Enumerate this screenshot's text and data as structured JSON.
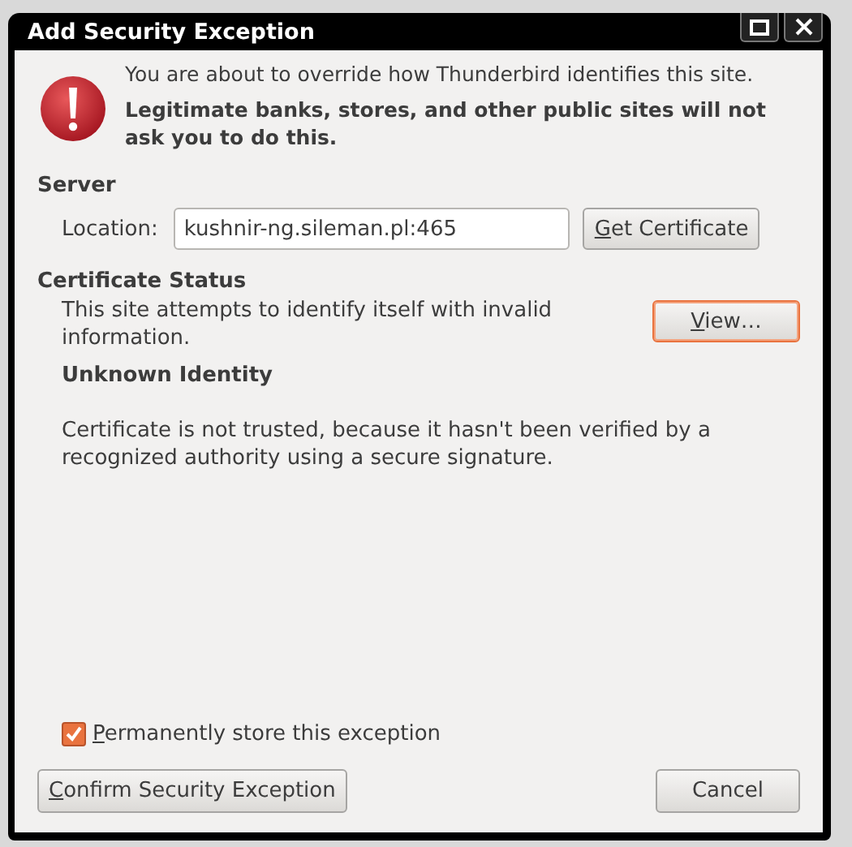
{
  "window": {
    "title": "Add Security Exception"
  },
  "warning": {
    "text": "You are about to override how Thunderbird identifies this site.",
    "emphasis": "Legitimate banks, stores, and other public sites will not ask you to do this."
  },
  "server": {
    "heading": "Server",
    "location_label": "Location:",
    "location_value": "kushnir-ng.sileman.pl:465",
    "button": {
      "label": "Get Certificate",
      "mnemonic": true,
      "focused": false
    }
  },
  "certificate_status": {
    "heading": "Certificate Status",
    "summary": "This site attempts to identify itself with invalid information.",
    "button": {
      "label": "View…",
      "mnemonic": true,
      "focused": true
    },
    "problem_title": "Unknown Identity",
    "problem_text": "Certificate is not trusted, because it hasn't been verified by a recognized authority using a secure signature."
  },
  "permanent": {
    "label": "Permanently store this exception",
    "checked": true,
    "mnemonic": true
  },
  "buttons": [
    {
      "label": "Confirm Security Exception",
      "mnemonic": true,
      "focused": false
    },
    {
      "label": "Cancel",
      "mnemonic": false,
      "focused": false
    }
  ]
}
